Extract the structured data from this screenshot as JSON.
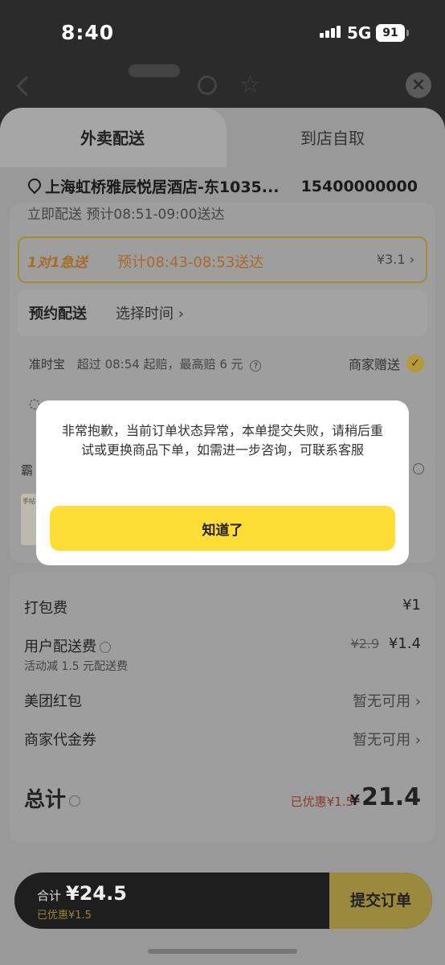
{
  "status_bar": {
    "time": "8:40",
    "network": "5G",
    "battery": "91"
  },
  "tabs": [
    {
      "label": "外卖配送",
      "active": true
    },
    {
      "label": "到店自取",
      "active": false
    }
  ],
  "address": {
    "text": "上海虹桥雅辰悦居酒店-东1035...",
    "phone": "15400000000"
  },
  "delivery": {
    "cut_row": "立即配送    预计08:51-09:00送达",
    "express": {
      "badge": "1对1急送",
      "eta": "预计08:43-08:53送达",
      "price": "¥3.1 ›"
    },
    "reserve": {
      "label": "预约配送",
      "value": "选择时间 ›"
    },
    "ontime": {
      "label": "准时宝",
      "desc": "超过 08:54 起赔，最高赔 6 元",
      "gift": "商家赠送"
    }
  },
  "shop": {
    "name": "霸",
    "thumb_text": "手帖茶"
  },
  "fees": {
    "packing": {
      "label": "打包费",
      "value": "¥1"
    },
    "user_delivery": {
      "label": "用户配送费",
      "old": "¥2.9",
      "value": "¥1.4",
      "note": "活动减 1.5 元配送费"
    },
    "red_packet": {
      "label": "美团红包",
      "value": "暂无可用 ›"
    },
    "voucher": {
      "label": "商家代金券",
      "value": "暂无可用 ›"
    },
    "total": {
      "label": "总计",
      "discount": "已优惠¥1.5",
      "currency": "¥",
      "amount": "21.4"
    }
  },
  "bottom_bar": {
    "total_label": "合计",
    "total_amount": "¥24.5",
    "discount": "已优惠¥1.5",
    "submit": "提交订单"
  },
  "modal": {
    "message": "非常抱歉，当前订单状态异常，本单提交失败，请稍后重试或更换商品下单，如需进一步咨询，可联系客服",
    "button": "知道了"
  },
  "colors": {
    "accent": "#ffdd37",
    "overlay": "rgba(0,0,0,0.4)"
  }
}
